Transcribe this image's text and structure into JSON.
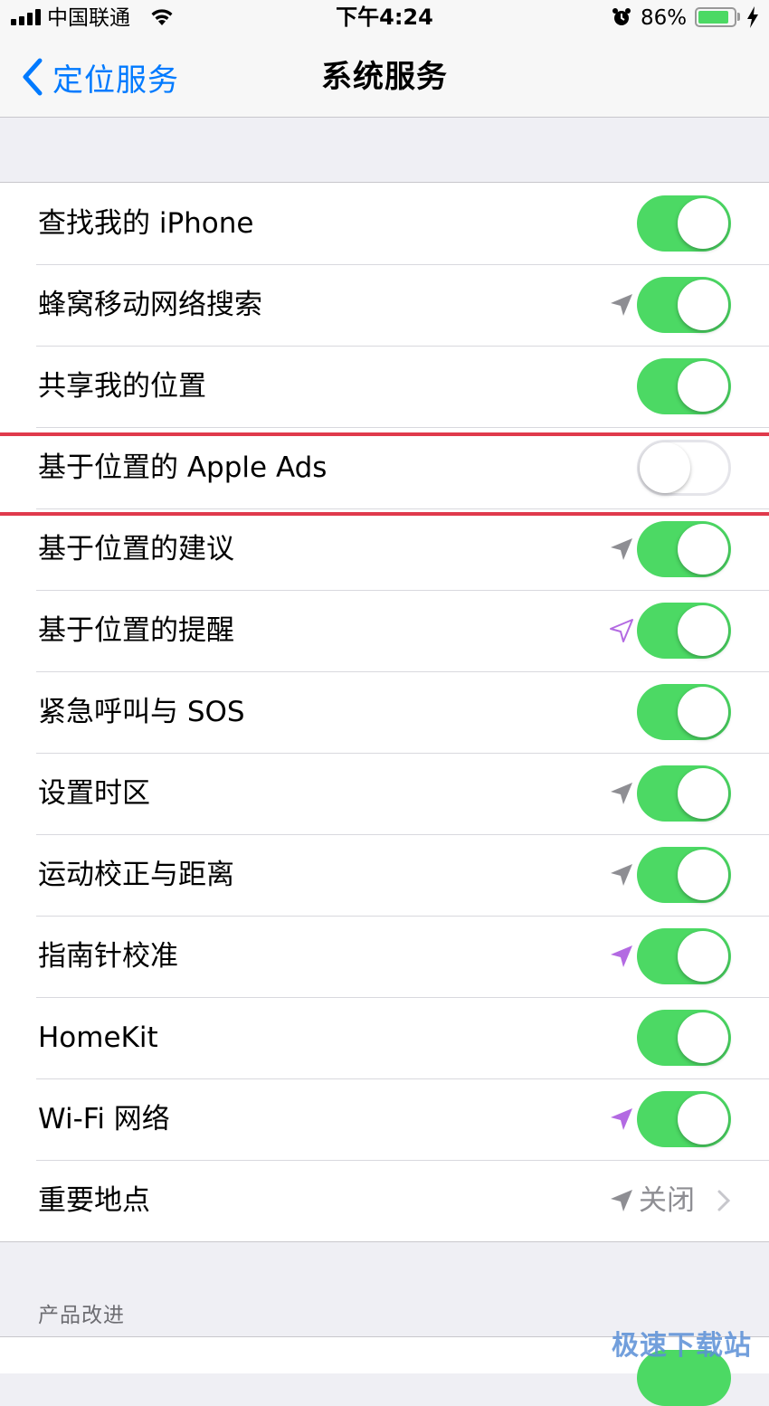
{
  "status_bar": {
    "carrier": "中国联通",
    "time": "下午4:24",
    "battery_percent": "86%",
    "battery_level": 0.86,
    "icons": [
      "signal-icon",
      "wifi-icon",
      "alarm-icon",
      "battery-icon",
      "charging-bolt-icon"
    ]
  },
  "nav": {
    "back_label": "定位服务",
    "title": "系统服务"
  },
  "colors": {
    "switch_on": "#4cd964",
    "accent": "#007aff",
    "highlight": "#e03a4c",
    "arrow_gray": "#8e8e93",
    "arrow_purple": "#b36ae2"
  },
  "rows": [
    {
      "label": "查找我的 iPhone",
      "switch": true,
      "location_indicator": "none"
    },
    {
      "label": "蜂窝移动网络搜索",
      "switch": true,
      "location_indicator": "gray-filled"
    },
    {
      "label": "共享我的位置",
      "switch": true,
      "location_indicator": "none"
    },
    {
      "label": "基于位置的 Apple Ads",
      "switch": false,
      "location_indicator": "none",
      "highlighted": true
    },
    {
      "label": "基于位置的建议",
      "switch": true,
      "location_indicator": "gray-filled"
    },
    {
      "label": "基于位置的提醒",
      "switch": true,
      "location_indicator": "purple-outline"
    },
    {
      "label": "紧急呼叫与 SOS",
      "switch": true,
      "location_indicator": "none"
    },
    {
      "label": "设置时区",
      "switch": true,
      "location_indicator": "gray-filled"
    },
    {
      "label": "运动校正与距离",
      "switch": true,
      "location_indicator": "gray-filled"
    },
    {
      "label": "指南针校准",
      "switch": true,
      "location_indicator": "purple-filled"
    },
    {
      "label": "HomeKit",
      "switch": true,
      "location_indicator": "none"
    },
    {
      "label": "Wi-Fi 网络",
      "switch": true,
      "location_indicator": "purple-filled"
    },
    {
      "label": "重要地点",
      "value": "关闭",
      "location_indicator": "gray-filled",
      "disclosure": true
    }
  ],
  "section2": {
    "header": "产品改进",
    "row_switch": true
  },
  "watermark": "极速下载站"
}
